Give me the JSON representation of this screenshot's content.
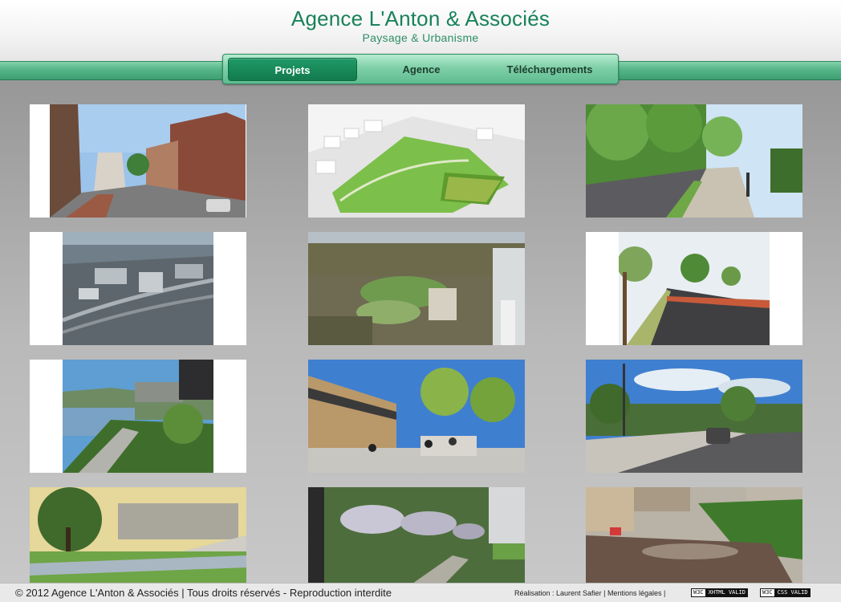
{
  "header": {
    "title": "Agence L'Anton & Associés",
    "subtitle": "Paysage & Urbanisme"
  },
  "nav": {
    "items": [
      {
        "label": "Projets",
        "active": true
      },
      {
        "label": "Agence",
        "active": false
      },
      {
        "label": "Téléchargements",
        "active": false
      }
    ]
  },
  "colors": {
    "brand_green": "#19825a",
    "nav_active": "#137a4e"
  },
  "footer": {
    "copyright": "© 2012 Agence L'Anton & Associés | Tous droits réservés - Reproduction interdite",
    "realisation": "Réalisation : Laurent Safier",
    "separator1": "|",
    "mentions": "Mentions légales",
    "separator2": "|",
    "badges": [
      {
        "w3c": "W3C",
        "label": "XHTML VALID"
      },
      {
        "w3c": "W3C",
        "label": "CSS VALID"
      }
    ]
  }
}
